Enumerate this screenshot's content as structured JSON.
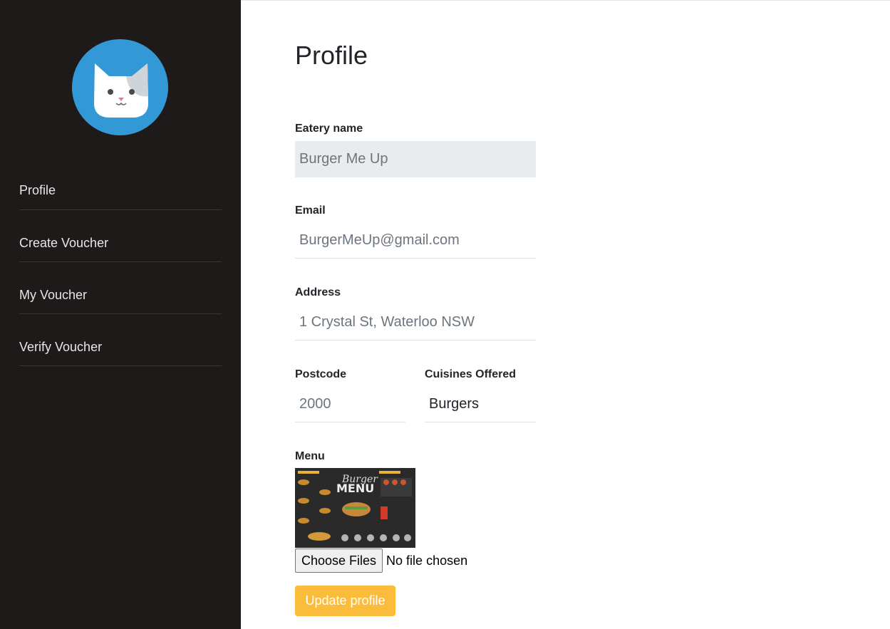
{
  "sidebar": {
    "avatar_icon": "cat-face-icon",
    "items": [
      {
        "label": "Profile"
      },
      {
        "label": "Create Voucher"
      },
      {
        "label": "My Voucher"
      },
      {
        "label": "Verify Voucher"
      }
    ]
  },
  "profile": {
    "title": "Profile",
    "eatery_name": {
      "label": "Eatery name",
      "value": "Burger Me Up"
    },
    "email": {
      "label": "Email",
      "value": "BurgerMeUp@gmail.com"
    },
    "address": {
      "label": "Address",
      "value": "1 Crystal St, Waterloo NSW"
    },
    "postcode": {
      "label": "Postcode",
      "value": "2000"
    },
    "cuisines": {
      "label": "Cuisines Offered",
      "value": "Burgers"
    },
    "menu": {
      "label": "Menu",
      "choose_files_label": "Choose Files",
      "file_status": "No file chosen"
    },
    "update_label": "Update profile"
  },
  "colors": {
    "sidebar_bg": "#1e1a19",
    "avatar_bg": "#3399d6",
    "accent_button": "#fbbb3b",
    "readonly_field": "#e9ecef"
  }
}
